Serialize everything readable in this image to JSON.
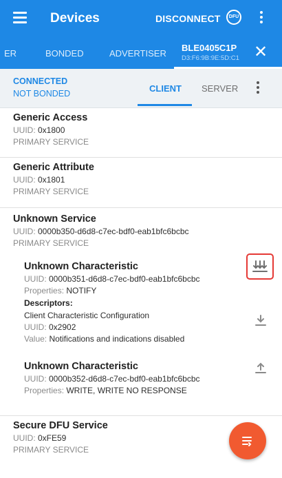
{
  "appbar": {
    "title": "Devices",
    "disconnect_label": "DISCONNECT",
    "dfu_badge": "DFU"
  },
  "tabs": {
    "partial": "ER",
    "bonded": "BONDED",
    "advertiser": "ADVERTISER",
    "device_name": "BLE0405C1P",
    "device_mac": "D3:F6:9B:9E:5D:C1"
  },
  "status": {
    "connection": "CONNECTED",
    "bond": "NOT BONDED",
    "client_tab": "CLIENT",
    "server_tab": "SERVER"
  },
  "services": [
    {
      "title": "Generic Access",
      "uuid_label": "UUID: ",
      "uuid": "0x1800",
      "type": "PRIMARY SERVICE"
    },
    {
      "title": "Generic Attribute",
      "uuid_label": "UUID: ",
      "uuid": "0x1801",
      "type": "PRIMARY SERVICE"
    },
    {
      "title": "Unknown Service",
      "uuid_label": "UUID: ",
      "uuid": "0000b350-d6d8-c7ec-bdf0-eab1bfc6bcbc",
      "type": "PRIMARY SERVICE"
    },
    {
      "title": "Secure DFU Service",
      "uuid_label": "UUID: ",
      "uuid": "0xFE59",
      "type": "PRIMARY SERVICE"
    }
  ],
  "characteristics": [
    {
      "title": "Unknown Characteristic",
      "uuid_label": "UUID: ",
      "uuid": "0000b351-d6d8-c7ec-bdf0-eab1bfc6bcbc",
      "props_label": "Properties: ",
      "props": "NOTIFY",
      "descriptors_label": "Descriptors:",
      "descriptor": {
        "name": "Client Characteristic Configuration",
        "uuid_label": "UUID: ",
        "uuid": "0x2902",
        "value_label": "Value: ",
        "value": "Notifications and indications disabled"
      }
    },
    {
      "title": "Unknown Characteristic",
      "uuid_label": "UUID: ",
      "uuid": "0000b352-d6d8-c7ec-bdf0-eab1bfc6bcbc",
      "props_label": "Properties: ",
      "props": "WRITE, WRITE NO RESPONSE"
    }
  ],
  "colors": {
    "primary": "#1e88e5",
    "accent": "#f15a30",
    "highlight_box": "#e53935"
  }
}
